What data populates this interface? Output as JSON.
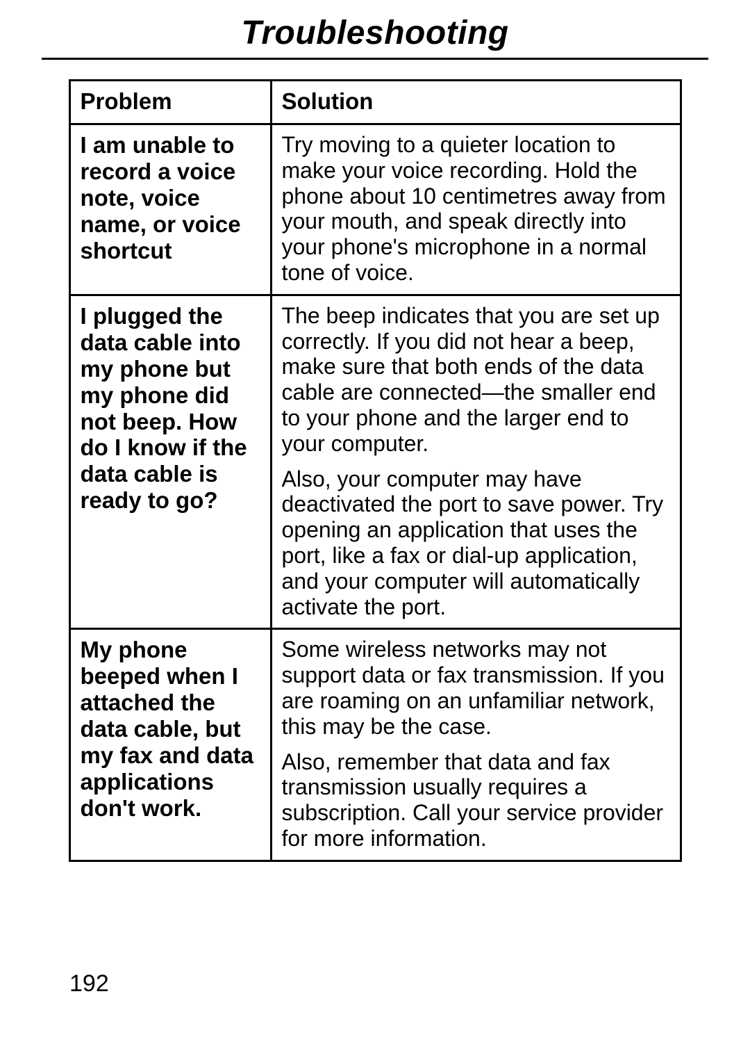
{
  "title": "Troubleshooting",
  "headers": {
    "problem": "Problem",
    "solution": "Solution"
  },
  "rows": [
    {
      "problem": "I am unable to record a voice note, voice name, or voice shortcut",
      "solution": [
        "Try moving to a quieter location to make your voice recording. Hold the phone about 10 centimetres away from your mouth, and speak directly into your phone's microphone in a normal tone of voice."
      ]
    },
    {
      "problem": "I plugged the data cable into my phone but my phone did not beep. How do I know if the data cable is ready to go?",
      "solution": [
        "The beep indicates that you are set up correctly. If you did not hear a beep, make sure that both ends of the data cable are connected—the smaller end to your phone and the larger end to your computer.",
        "Also, your computer may have deactivated the port to save power. Try opening an application that uses the port, like a fax or dial-up application, and your computer will automatically activate the port."
      ]
    },
    {
      "problem": "My phone beeped when I attached the data cable, but my fax and data applications don't work.",
      "solution": [
        "Some wireless networks may not support data or fax transmission. If you are roaming on an unfamiliar network, this may be the case.",
        "Also, remember that data and fax transmission usually requires a subscription. Call your service provider for more information."
      ]
    }
  ],
  "page_number": "192"
}
